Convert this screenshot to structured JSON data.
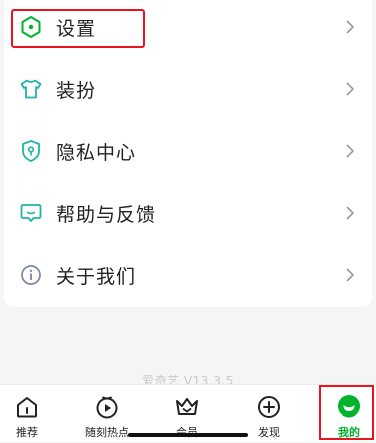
{
  "menu": {
    "items": [
      {
        "label": "设置",
        "icon": "settings-icon"
      },
      {
        "label": "装扮",
        "icon": "shirt-icon"
      },
      {
        "label": "隐私中心",
        "icon": "privacy-shield-icon"
      },
      {
        "label": "帮助与反馈",
        "icon": "feedback-icon"
      },
      {
        "label": "关于我们",
        "icon": "info-icon"
      }
    ]
  },
  "version": "爱奇艺 V13.3.5",
  "tabbar": {
    "tabs": [
      {
        "label": "推荐",
        "icon": "home-icon"
      },
      {
        "label": "随刻热点",
        "icon": "play-circle-icon"
      },
      {
        "label": "会员",
        "icon": "vip-crown-icon"
      },
      {
        "label": "发现",
        "icon": "discover-plus-icon"
      },
      {
        "label": "我的",
        "icon": "profile-icon",
        "active": true
      }
    ]
  },
  "colors": {
    "accent": "#00b32c",
    "highlight": "#e8141e",
    "icon_teal": "#1fb5a8"
  }
}
